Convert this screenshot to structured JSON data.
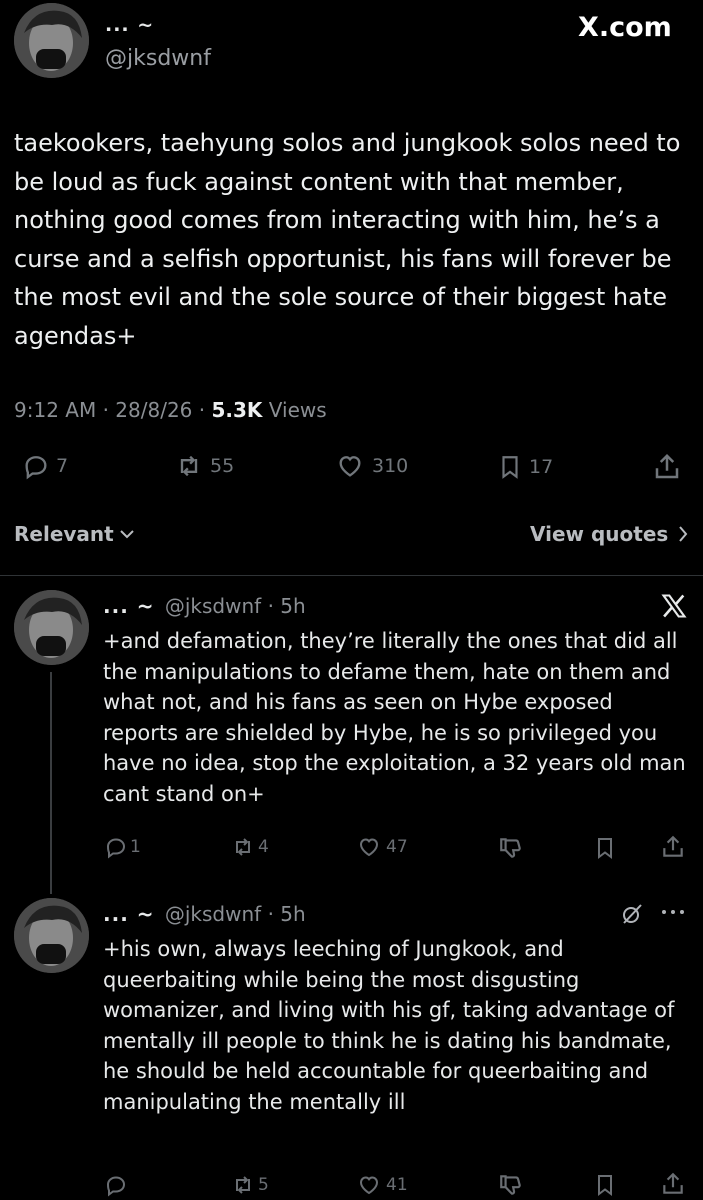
{
  "brand": "X.com",
  "main_post": {
    "display_name": "... ~",
    "handle": "@jksdwnf",
    "text": "taekookers, taehyung solos and jungkook solos need to be loud as fuck against content with that member, nothing good comes from interacting with him, he’s a curse and a selfish opportunist, his fans will forever be the most evil and the sole source of their biggest hate agendas+",
    "time": "9:12 AM",
    "date": "28/8/26",
    "views_count": "5.3K",
    "views_label": "Views",
    "replies": "7",
    "reposts": "55",
    "likes": "310",
    "bookmarks": "17"
  },
  "sort_bar": {
    "relevant_label": "Relevant",
    "view_quotes_label": "View quotes"
  },
  "replies": [
    {
      "display_name": "... ~",
      "handle": "@jksdwnf",
      "age": "5h",
      "text": "+and defamation, they’re literally the ones that did all the manipulations to defame them, hate on them and what not, and his fans as seen on Hybe exposed reports are shielded by Hybe, he is so privileged you have no idea, stop the exploitation, a 32 years old man cant stand on+",
      "replies": "1",
      "reposts": "4",
      "likes": "47"
    },
    {
      "display_name": "... ~",
      "handle": "@jksdwnf",
      "age": "5h",
      "text": "+his own, always leeching of Jungkook, and queerbaiting while being the most disgusting womanizer, and living with his gf, taking advantage of mentally ill people to think he is dating his bandmate, he should be held accountable for queerbaiting and manipulating the mentally ill",
      "replies": "",
      "reposts": "5",
      "likes": "41"
    }
  ]
}
